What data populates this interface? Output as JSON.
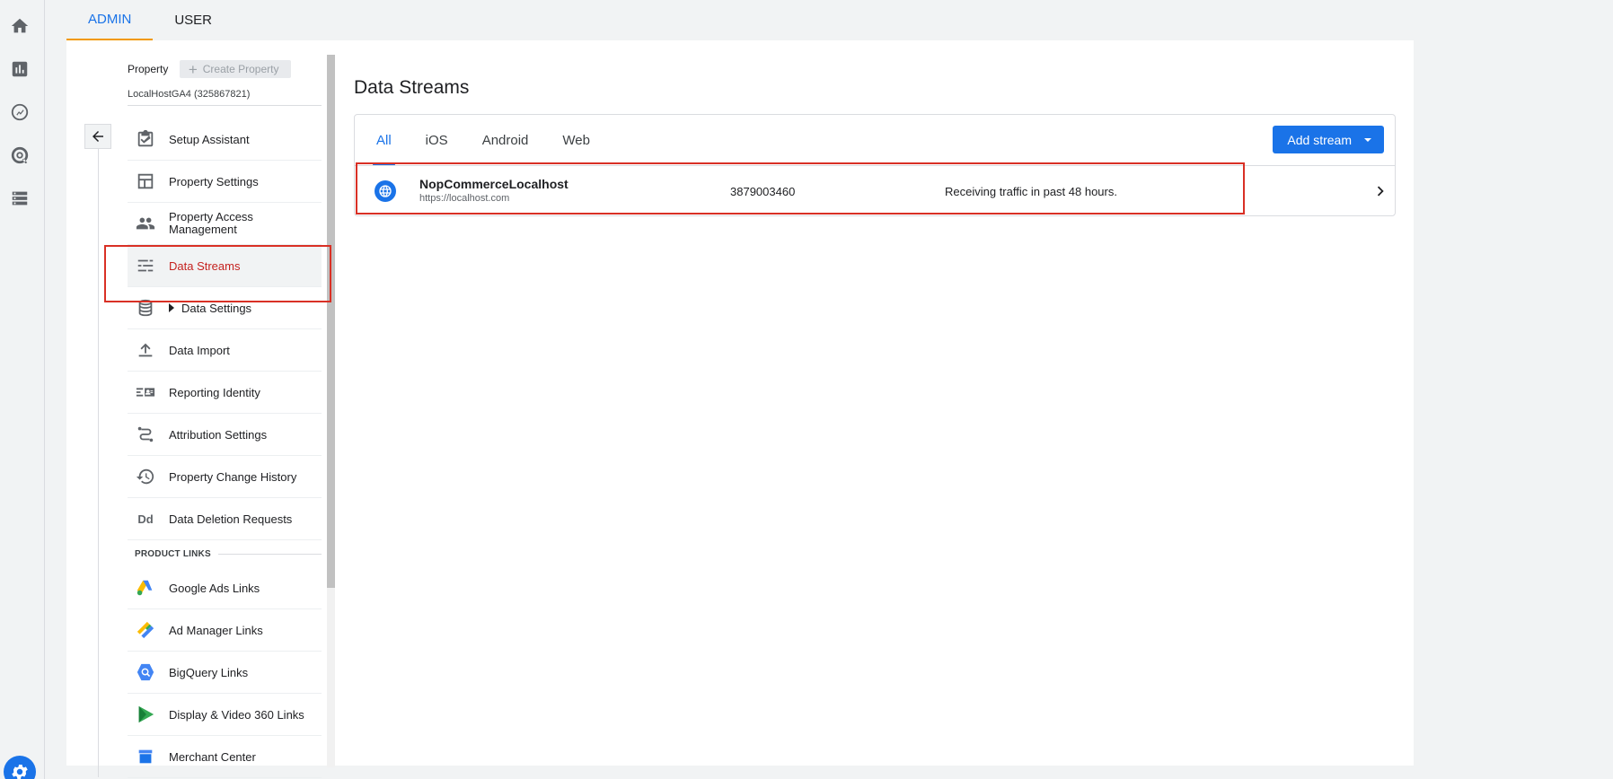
{
  "top_tabs": [
    {
      "label": "ADMIN",
      "active": true
    },
    {
      "label": "USER",
      "active": false
    }
  ],
  "property": {
    "label": "Property",
    "create_label": "Create Property",
    "name": "LocalHostGA4 (325867821)"
  },
  "nav": {
    "items": [
      {
        "label": "Setup Assistant",
        "icon": "checkbox-icon"
      },
      {
        "label": "Property Settings",
        "icon": "layout-icon"
      },
      {
        "label": "Property Access Management",
        "icon": "people-icon"
      },
      {
        "label": "Data Streams",
        "icon": "streams-icon",
        "active": true
      },
      {
        "label": "Data Settings",
        "icon": "database-icon"
      },
      {
        "label": "Data Import",
        "icon": "upload-icon"
      },
      {
        "label": "Reporting Identity",
        "icon": "identity-icon"
      },
      {
        "label": "Attribution Settings",
        "icon": "attribution-icon"
      },
      {
        "label": "Property Change History",
        "icon": "history-icon"
      },
      {
        "label": "Data Deletion Requests",
        "icon": "dd-icon"
      }
    ],
    "dd_text": "Dd",
    "section_title": "PRODUCT LINKS",
    "product_links": [
      {
        "label": "Google Ads Links",
        "icon": "google-ads-icon"
      },
      {
        "label": "Ad Manager Links",
        "icon": "ad-manager-icon"
      },
      {
        "label": "BigQuery Links",
        "icon": "bigquery-icon"
      },
      {
        "label": "Display & Video 360 Links",
        "icon": "dv360-icon"
      },
      {
        "label": "Merchant Center",
        "icon": "merchant-center-icon"
      }
    ]
  },
  "content": {
    "title": "Data Streams",
    "tabs": [
      {
        "label": "All",
        "active": true
      },
      {
        "label": "iOS"
      },
      {
        "label": "Android"
      },
      {
        "label": "Web"
      }
    ],
    "add_stream_label": "Add stream",
    "streams": [
      {
        "name": "NopCommerceLocalhost",
        "url": "https://localhost.com",
        "id": "3879003460",
        "status": "Receiving traffic in past 48 hours."
      }
    ]
  },
  "colors": {
    "accent": "#1a73e8",
    "active_nav_text": "#c5221f",
    "highlight_border": "#d93025",
    "tab_indicator": "#f29900"
  }
}
